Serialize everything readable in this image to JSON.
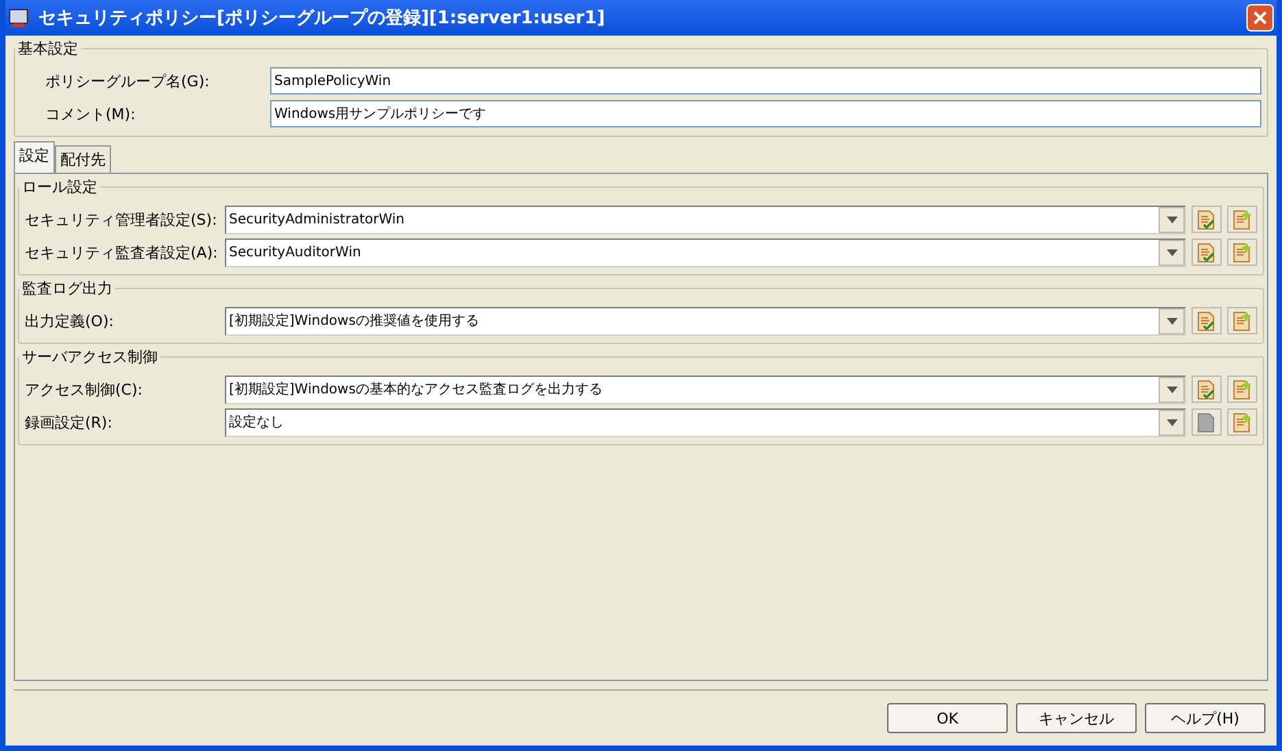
{
  "window": {
    "title": "セキュリティポリシー[ポリシーグループの登録][1:server1:user1]"
  },
  "basic": {
    "title": "基本設定",
    "fields": [
      {
        "label": "ポリシーグループ名(G):",
        "value": "SamplePolicyWin"
      },
      {
        "label": "コメント(M):",
        "value": "Windows用サンプルポリシーです"
      }
    ]
  },
  "tabs": [
    {
      "label": "設定",
      "selected": true
    },
    {
      "label": "配付先",
      "selected": false
    }
  ],
  "sections": [
    {
      "title": "ロール設定",
      "rows": [
        {
          "label": "セキュリティ管理者設定(S):",
          "value": "SecurityAdministratorWin",
          "edit_enabled": true
        },
        {
          "label": "セキュリティ監査者設定(A):",
          "value": "SecurityAuditorWin",
          "edit_enabled": true
        }
      ]
    },
    {
      "title": "監査ログ出力",
      "rows": [
        {
          "label": "出力定義(O):",
          "value": "[初期設定]Windowsの推奨値を使用する",
          "edit_enabled": true
        }
      ]
    },
    {
      "title": "サーバアクセス制御",
      "rows": [
        {
          "label": "アクセス制御(C):",
          "value": "[初期設定]Windowsの基本的なアクセス監査ログを出力する",
          "edit_enabled": true
        },
        {
          "label": "録画設定(R):",
          "value": "設定なし",
          "edit_enabled": false
        }
      ]
    }
  ],
  "buttons": [
    "OK",
    "キャンセル",
    "ヘルプ(H)"
  ]
}
